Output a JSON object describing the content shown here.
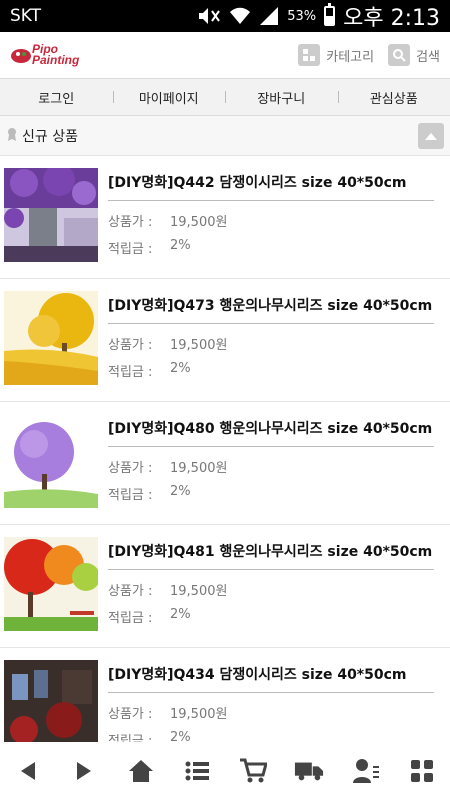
{
  "status_bar": {
    "carrier": "SKT",
    "battery": "53%",
    "battery_level": 0.53,
    "time": "오후 2:13"
  },
  "header": {
    "logo_line1": "Pipo",
    "logo_line2": "Painting",
    "category_label": "카테고리",
    "search_label": "검색"
  },
  "nav": {
    "items": [
      "로그인",
      "마이페이지",
      "장바구니",
      "관심상품"
    ]
  },
  "section": {
    "title": "신규 상품"
  },
  "labels": {
    "price": "상품가 :",
    "points": "적립금 :"
  },
  "products": [
    {
      "title": "[DIY명화]Q442 담쟁이시리즈 size 40*50cm",
      "price": "19,500원",
      "points": "2%"
    },
    {
      "title": "[DIY명화]Q473 행운의나무시리즈 size 40*50cm",
      "price": "19,500원",
      "points": "2%"
    },
    {
      "title": "[DIY명화]Q480 행운의나무시리즈 size 40*50cm",
      "price": "19,500원",
      "points": "2%"
    },
    {
      "title": "[DIY명화]Q481 행운의나무시리즈 size 40*50cm",
      "price": "19,500원",
      "points": "2%"
    },
    {
      "title": "[DIY명화]Q434 담쟁이시리즈 size 40*50cm",
      "price": "19,500원",
      "points": "2%"
    }
  ],
  "bottom_bar": {
    "icons": [
      "back-icon",
      "forward-icon",
      "home-icon",
      "list-icon",
      "cart-icon",
      "delivery-icon",
      "user-icon",
      "grid-icon"
    ]
  },
  "colors": {
    "nav_bg": "#f2f2f2",
    "icon": "#444444",
    "logo_red": "#c8283c"
  }
}
